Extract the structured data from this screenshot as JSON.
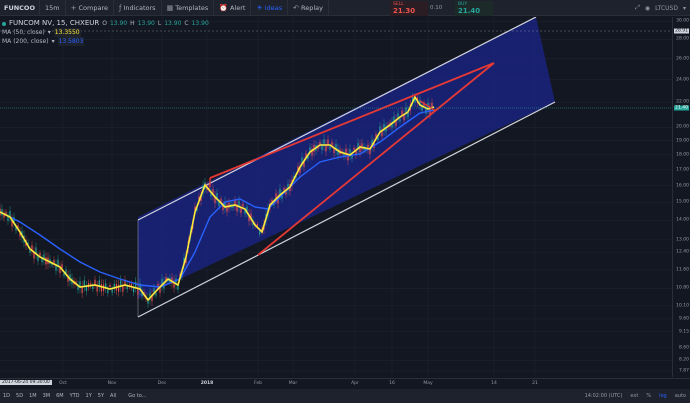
{
  "toolbar": {
    "symbol": "FUNCOO",
    "interval": "15m",
    "compare": "Compare",
    "indicators": "Indicators",
    "templates": "Templates",
    "alert": "Alert",
    "ideas": "Ideas",
    "replay": "Replay",
    "sell_label": "SELL",
    "sell_price": "21.30",
    "spread": "0.10",
    "buy_label": "BUY",
    "buy_price": "21.40",
    "right_symbol": "LTCUSD"
  },
  "legend": {
    "title": "FUNCOM NV, 15, CHXEUR",
    "ohlc": {
      "o_label": "O",
      "o": "13.90",
      "h_label": "H",
      "h": "13.90",
      "l_label": "L",
      "l": "13.90",
      "c_label": "C",
      "c": "13.90"
    },
    "ma1": {
      "label": "MA (50, close)",
      "value": "13.3550"
    },
    "ma2": {
      "label": "MA (200, close)",
      "value": "13.5803"
    }
  },
  "price_axis": {
    "labels": [
      "30.00",
      "28.00",
      "26.00",
      "24.00",
      "22.00",
      "20.00",
      "19.00",
      "18.00",
      "17.00",
      "16.00",
      "15.00",
      "14.00",
      "13.00",
      "12.40",
      "11.60",
      "10.80",
      "10.10",
      "9.60",
      "9.15",
      "8.60",
      "8.20",
      "7.87"
    ],
    "hl_price": "21.40",
    "top_price": "28.91"
  },
  "time_axis": {
    "cursor_date": "2017-06-24 09:30:00",
    "labels": [
      "Oct",
      "Nov",
      "Dec",
      "2018",
      "Feb",
      "Mar",
      "Apr",
      "16",
      "May",
      "14",
      "21"
    ]
  },
  "bottombar": {
    "timeframes": [
      "1D",
      "5D",
      "1M",
      "3M",
      "6M",
      "YTD",
      "1Y",
      "5Y",
      "All"
    ],
    "goto": "Go to...",
    "clock": "14:02:00 (UTC)",
    "ext": "ext",
    "pct": "%",
    "log": "log",
    "auto": "auto"
  },
  "colors": {
    "background": "#131722",
    "channel_fill": "#1a237e",
    "ma_fast": "#ffeb3b",
    "ma_slow": "#2962ff",
    "wedge": "#e53935",
    "candle_up": "#26a69a",
    "candle_down": "#ef5350"
  }
}
